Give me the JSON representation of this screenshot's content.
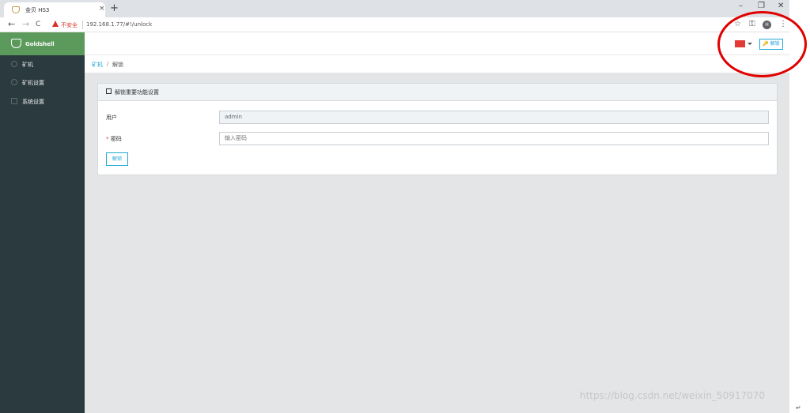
{
  "browser": {
    "tab_title": "金贝 HS3",
    "tab_close": "×",
    "new_tab": "+",
    "window_controls": {
      "minimize": "–",
      "restore": "❐",
      "close": "✕"
    },
    "nav": {
      "back": "←",
      "forward": "→",
      "reload": "C"
    },
    "security_label": "不安全",
    "url": "192.168.1.77/#!/unlock",
    "star_icon": "☆",
    "key_icon": "⚿",
    "profile_initial": "H",
    "menu_icon": "⋮"
  },
  "sidebar": {
    "brand": "Goldshell",
    "items": [
      {
        "label": "矿机",
        "icon": "star-icon"
      },
      {
        "label": "矿机设置",
        "icon": "gear-icon"
      },
      {
        "label": "系统设置",
        "icon": "monitor-icon"
      }
    ]
  },
  "topbar": {
    "flag_color": "#e53935",
    "unlock_label": "🔑 解锁"
  },
  "breadcrumb": {
    "parent": "矿机",
    "separator": "/",
    "current": "解锁"
  },
  "card": {
    "title": "解锁重要功能设置",
    "user_label": "用户",
    "user_value": "admin",
    "password_required": "*",
    "password_label": "密码",
    "password_placeholder": "输入密码",
    "submit_label": "解锁"
  },
  "overlay": {
    "watermark": "https://blog.csdn.net/weixin_50917070",
    "corner_mark": "↵"
  },
  "colors": {
    "accent": "#20a8d8",
    "sidebar_bg": "#2b3a3f",
    "brand_green": "#5b9a5b",
    "annotation_red": "#e00000"
  }
}
